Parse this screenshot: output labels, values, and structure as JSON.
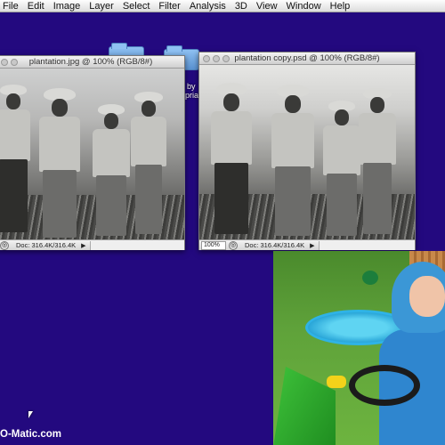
{
  "menubar": {
    "items": [
      "File",
      "Edit",
      "Image",
      "Layer",
      "Select",
      "Filter",
      "Analysis",
      "3D",
      "View",
      "Window",
      "Help"
    ]
  },
  "desktop": {
    "partial_label_1": "by",
    "partial_label_2": "pria"
  },
  "window_left": {
    "title": "plantation.jpg @ 100% (RGB/8#)",
    "doc_size": "Doc: 316.4K/316.4K"
  },
  "window_right": {
    "title": "plantation copy.psd @ 100% (RGB/8#)",
    "zoom": "100%",
    "doc_size": "Doc: 316.4K/316.4K"
  },
  "watermark": {
    "text": "O-Matic.com"
  },
  "colors": {
    "desktop_bg": "#23097f"
  }
}
